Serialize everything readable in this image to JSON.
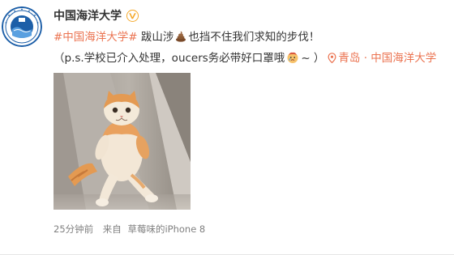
{
  "post": {
    "author": {
      "name": "中国海洋大学",
      "verified_color": "#f5a623"
    },
    "content": {
      "hashtag": "#中国海洋大学#",
      "line1_text_a": " 跋山涉",
      "line1_text_b": "也挡不住我们求知的步伐！",
      "line2_text_a": "（p.s.学校已介入处理，oucers务必带好口罩哦",
      "line2_text_b": "~ ）",
      "location": "青岛 · 中国海洋大学"
    },
    "meta": {
      "time": "25分钟前",
      "source_prefix": "来自",
      "source": "草莓味的iPhone 8"
    },
    "colors": {
      "link": "#eb7350",
      "text": "#333333",
      "meta": "#808080"
    }
  }
}
